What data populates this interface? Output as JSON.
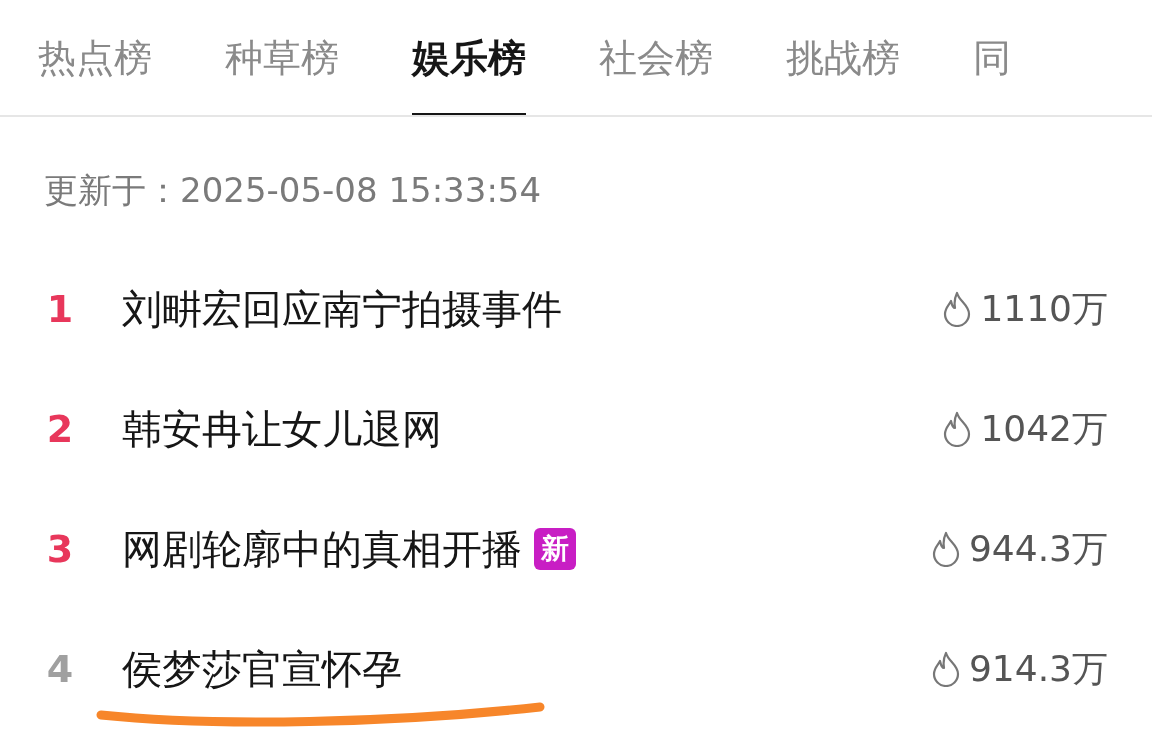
{
  "tabs": [
    {
      "label": "热点榜",
      "selected": false
    },
    {
      "label": "种草榜",
      "selected": false
    },
    {
      "label": "娱乐榜",
      "selected": true
    },
    {
      "label": "社会榜",
      "selected": false
    },
    {
      "label": "挑战榜",
      "selected": false
    },
    {
      "label": "同",
      "selected": false
    }
  ],
  "updated": "更新于：2025-05-08 15:33:54",
  "items": [
    {
      "rank": "1",
      "color": "#e8375b",
      "title": "刘畊宏回应南宁拍摄事件",
      "heat": "1110万",
      "underlined": false
    },
    {
      "rank": "2",
      "color": "#e8375b",
      "title": "韩安冉让女儿退网",
      "heat": "1042万",
      "underlined": false
    },
    {
      "rank": "3",
      "color": "#e8375b",
      "title": "网剧轮廓中的真相开播",
      "badge": "新",
      "heat": "944.3万",
      "underlined": false
    },
    {
      "rank": "4",
      "color": "#a0a0a0",
      "title": "侯梦莎官宣怀孕",
      "heat": "914.3万",
      "underlined": true
    }
  ]
}
